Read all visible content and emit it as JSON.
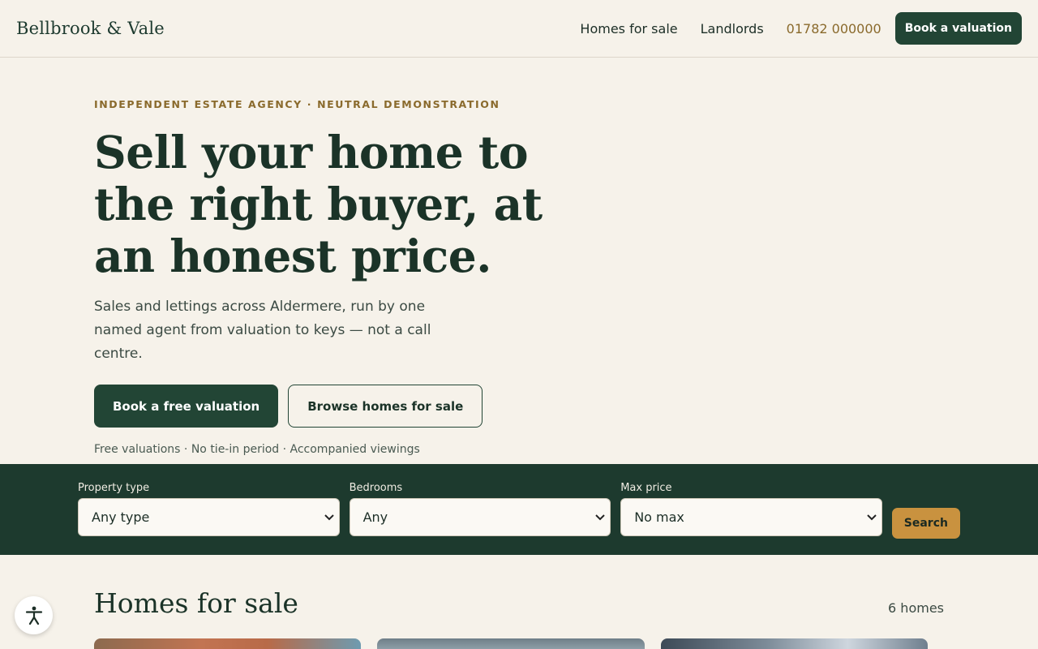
{
  "header": {
    "brand": "Bellbrook & Vale",
    "nav": [
      "Homes for sale",
      "Landlords"
    ],
    "phone": "01782 000000",
    "cta": "Book a valuation"
  },
  "hero": {
    "eyebrow": "INDEPENDENT ESTATE AGENCY · NEUTRAL DEMONSTRATION",
    "title": "Sell your home to the right buyer, at an honest price.",
    "lead": "Sales and lettings across Aldermere, run by one named agent from valuation to keys — not a call centre.",
    "primary_cta": "Book a free valuation",
    "secondary_cta": "Browse homes for sale",
    "trust": "Free valuations · No tie-in period · Accompanied viewings"
  },
  "search": {
    "fields": [
      {
        "label": "Property type",
        "value": "Any type"
      },
      {
        "label": "Bedrooms",
        "value": "Any"
      },
      {
        "label": "Max price",
        "value": "No max"
      }
    ],
    "button": "Search"
  },
  "listings": {
    "title": "Homes for sale",
    "count": "6 homes"
  },
  "colors": {
    "primary": "#224535",
    "band": "#1d3a2e",
    "accent": "#c9923f",
    "background": "#f6f2ea"
  },
  "icons": {
    "accessibility": "accessibility-icon",
    "select": "chevron-down-icon"
  }
}
